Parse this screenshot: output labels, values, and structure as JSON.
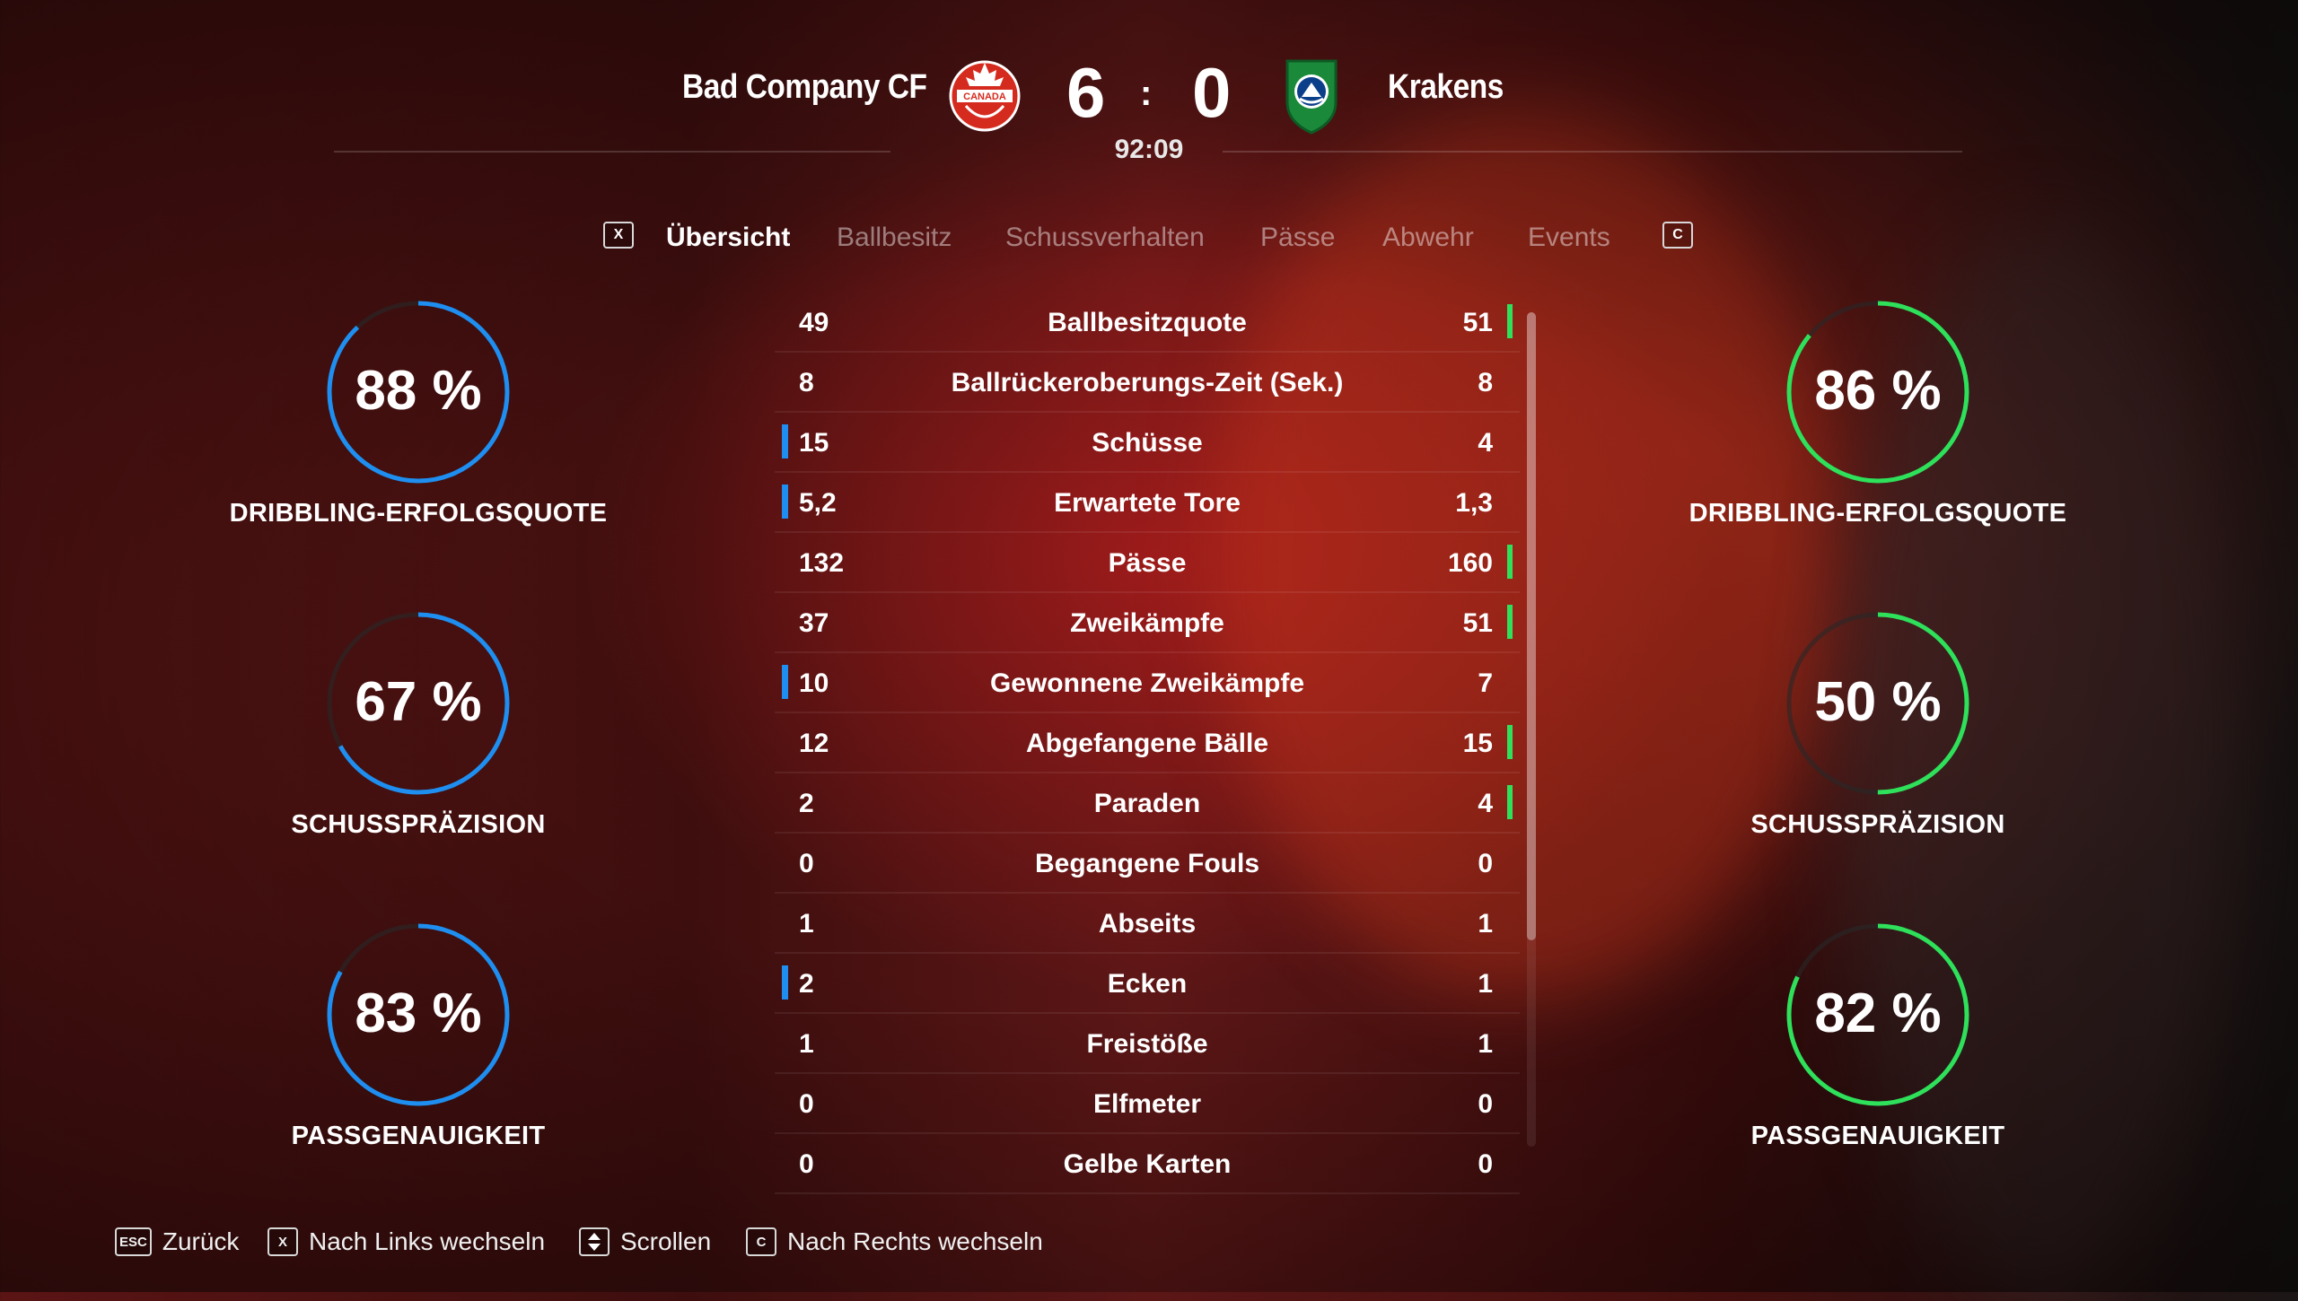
{
  "match": {
    "home_name": "Bad Company CF",
    "away_name": "Krakens",
    "home_score": "6",
    "away_score": "0",
    "separator": ":",
    "clock": "92:09",
    "home_crest_text": "CANADA"
  },
  "tabs": {
    "left_key": "X",
    "right_key": "C",
    "items": [
      "Übersicht",
      "Ballbesitz",
      "Schussverhalten",
      "Pässe",
      "Abwehr",
      "Events"
    ],
    "active": "Übersicht"
  },
  "rings": {
    "home": [
      {
        "value": "88 %",
        "pct": 88,
        "label": "DRIBBLING-ERFOLGSQUOTE"
      },
      {
        "value": "67 %",
        "pct": 67,
        "label": "SCHUSSPRÄZISION"
      },
      {
        "value": "83 %",
        "pct": 83,
        "label": "PASSGENAUIGKEIT"
      }
    ],
    "away": [
      {
        "value": "86 %",
        "pct": 86,
        "label": "DRIBBLING-ERFOLGSQUOTE"
      },
      {
        "value": "50 %",
        "pct": 50,
        "label": "SCHUSSPRÄZISION"
      },
      {
        "value": "82 %",
        "pct": 82,
        "label": "PASSGENAUIGKEIT"
      }
    ],
    "home_color": "#1e8ff0",
    "away_color": "#2ee05a"
  },
  "stats": [
    {
      "label": "Ballbesitzquote",
      "home": "49",
      "away": "51",
      "lead": "away"
    },
    {
      "label": "Ballrückeroberungs-Zeit (Sek.)",
      "home": "8",
      "away": "8",
      "lead": ""
    },
    {
      "label": "Schüsse",
      "home": "15",
      "away": "4",
      "lead": "home"
    },
    {
      "label": "Erwartete Tore",
      "home": "5,2",
      "away": "1,3",
      "lead": "home"
    },
    {
      "label": "Pässe",
      "home": "132",
      "away": "160",
      "lead": "away"
    },
    {
      "label": "Zweikämpfe",
      "home": "37",
      "away": "51",
      "lead": "away"
    },
    {
      "label": "Gewonnene Zweikämpfe",
      "home": "10",
      "away": "7",
      "lead": "home"
    },
    {
      "label": "Abgefangene Bälle",
      "home": "12",
      "away": "15",
      "lead": "away"
    },
    {
      "label": "Paraden",
      "home": "2",
      "away": "4",
      "lead": "away"
    },
    {
      "label": "Begangene Fouls",
      "home": "0",
      "away": "0",
      "lead": ""
    },
    {
      "label": "Abseits",
      "home": "1",
      "away": "1",
      "lead": ""
    },
    {
      "label": "Ecken",
      "home": "2",
      "away": "1",
      "lead": "home"
    },
    {
      "label": "Freistöße",
      "home": "1",
      "away": "1",
      "lead": ""
    },
    {
      "label": "Elfmeter",
      "home": "0",
      "away": "0",
      "lead": ""
    },
    {
      "label": "Gelbe Karten",
      "home": "0",
      "away": "0",
      "lead": ""
    }
  ],
  "footer": {
    "back_key": "ESC",
    "back_label": "Zurück",
    "left_key": "X",
    "left_label": "Nach Links wechseln",
    "scroll_label": "Scrollen",
    "right_key": "C",
    "right_label": "Nach Rechts wechseln"
  }
}
